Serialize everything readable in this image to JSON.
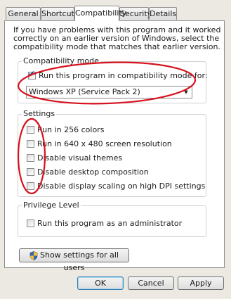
{
  "tabs": [
    {
      "label": "General",
      "active": false
    },
    {
      "label": "Shortcut",
      "active": false
    },
    {
      "label": "Compatibility",
      "active": true
    },
    {
      "label": "Security",
      "active": false
    },
    {
      "label": "Details",
      "active": false
    }
  ],
  "intro_text": "If you have problems with this program and it worked correctly on an earlier version of Windows, select the compatibility mode that matches that earlier version.",
  "compatibility_mode": {
    "legend": "Compatibility mode",
    "checkbox_label": "Run this program in compatibility mode for:",
    "checked": true,
    "selected_os": "Windows XP (Service Pack 2)"
  },
  "settings": {
    "legend": "Settings",
    "options": [
      {
        "label": "Run in 256 colors",
        "checked": false
      },
      {
        "label": "Run in 640 x 480 screen resolution",
        "checked": false
      },
      {
        "label": "Disable visual themes",
        "checked": false
      },
      {
        "label": "Disable desktop composition",
        "checked": false
      },
      {
        "label": "Disable display scaling on high DPI settings",
        "checked": false
      }
    ]
  },
  "privilege": {
    "legend": "Privilege Level",
    "checkbox_label": "Run this program as an administrator",
    "checked": false
  },
  "show_all_users_label": "Show settings for all users",
  "buttons": {
    "ok": "OK",
    "cancel": "Cancel",
    "apply": "Apply"
  },
  "colors": {
    "annotation": "#d6121d",
    "default_button_border": "#3c7fb1"
  }
}
